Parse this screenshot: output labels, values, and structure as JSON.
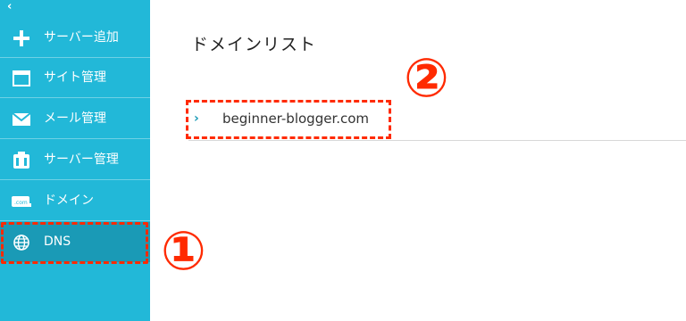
{
  "sidebar": {
    "collapse_icon": "chevron-left-icon",
    "items": [
      {
        "label": "サーバー追加",
        "icon": "plus-icon"
      },
      {
        "label": "サイト管理",
        "icon": "window-icon"
      },
      {
        "label": "メール管理",
        "icon": "mail-icon"
      },
      {
        "label": "サーバー管理",
        "icon": "server-icon"
      },
      {
        "label": "ドメイン",
        "icon": "domain-icon"
      },
      {
        "label": "DNS",
        "icon": "globe-icon",
        "active": true
      }
    ]
  },
  "main": {
    "title": "ドメインリスト",
    "domains": [
      {
        "name": "beginner-blogger.com"
      }
    ]
  },
  "annotations": {
    "callout_1": "①",
    "callout_2": "②",
    "color": "#ff2a00"
  },
  "colors": {
    "sidebar": "#22b8d8",
    "active": "#1a9ab6"
  }
}
